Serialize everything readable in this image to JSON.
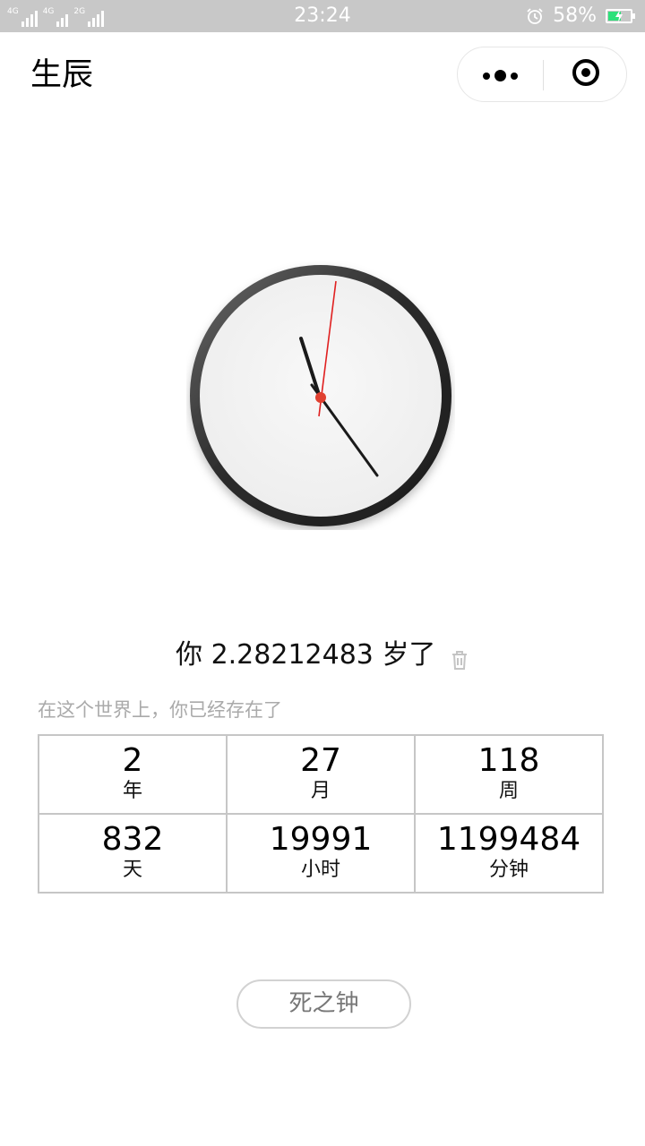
{
  "status_bar": {
    "network_tag_1": "4G",
    "network_tag_2": "4G",
    "network_tag_3": "2G",
    "time": "23:24",
    "battery_percent": "58%",
    "battery_level": 0.58,
    "battery_color": "#2ee07a",
    "alarm_icon": "alarm-clock-icon"
  },
  "nav": {
    "title": "生辰",
    "more_icon": "more-dots-icon",
    "close_icon": "target-close-icon"
  },
  "clock": {
    "face_color": "#f4f4f4",
    "rim_color": "#2a2a2a",
    "second_hand_color": "#e02020",
    "center_color": "#e04030"
  },
  "age": {
    "prefix": "你",
    "value": "2.28212483",
    "suffix": "岁了",
    "delete_icon": "trash-icon"
  },
  "caption": "在这个世界上，你已经存在了",
  "stats": [
    {
      "value": "2",
      "unit": "年"
    },
    {
      "value": "27",
      "unit": "月"
    },
    {
      "value": "118",
      "unit": "周"
    },
    {
      "value": "832",
      "unit": "天"
    },
    {
      "value": "19991",
      "unit": "小时"
    },
    {
      "value": "1199484",
      "unit": "分钟"
    }
  ],
  "button": {
    "label": "死之钟"
  }
}
